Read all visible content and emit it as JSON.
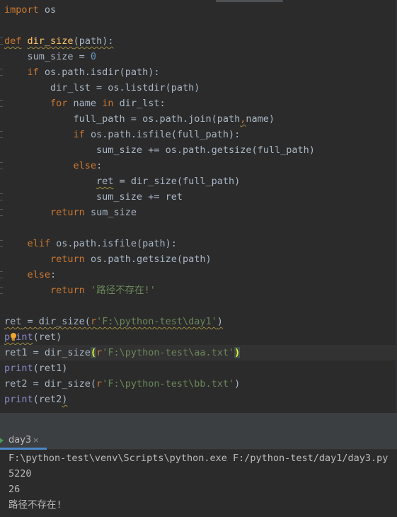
{
  "editor": {
    "lines": [
      {
        "segments": [
          {
            "t": "import",
            "c": "kw"
          },
          {
            "t": " os",
            "c": "pl"
          }
        ]
      },
      {
        "segments": []
      },
      {
        "segments": [
          {
            "t": "def",
            "c": "kw sq"
          },
          {
            "t": " ",
            "c": "pl"
          },
          {
            "t": "dir_size",
            "c": "fn sq"
          },
          {
            "t": "(path):",
            "c": "pl sq"
          }
        ],
        "fold": true
      },
      {
        "segments": [
          {
            "t": "    sum_size = ",
            "c": "pl"
          },
          {
            "t": "0",
            "c": "num"
          }
        ]
      },
      {
        "segments": [
          {
            "t": "    ",
            "c": "pl"
          },
          {
            "t": "if",
            "c": "kw"
          },
          {
            "t": " os.path.isdir(path):",
            "c": "pl"
          }
        ],
        "fold": true
      },
      {
        "segments": [
          {
            "t": "        dir_lst = os.listdir(path)",
            "c": "pl"
          }
        ]
      },
      {
        "segments": [
          {
            "t": "        ",
            "c": "pl"
          },
          {
            "t": "for",
            "c": "kw"
          },
          {
            "t": " name ",
            "c": "pl"
          },
          {
            "t": "in",
            "c": "kw"
          },
          {
            "t": " dir_lst:",
            "c": "pl"
          }
        ],
        "fold": true
      },
      {
        "segments": [
          {
            "t": "            full_path = os.path.join(path",
            "c": "pl"
          },
          {
            "t": ",",
            "c": "kw sq"
          },
          {
            "t": "name)",
            "c": "pl"
          }
        ]
      },
      {
        "segments": [
          {
            "t": "            ",
            "c": "pl"
          },
          {
            "t": "if",
            "c": "kw"
          },
          {
            "t": " os.path.isfile(full_path):",
            "c": "pl"
          }
        ],
        "fold": true
      },
      {
        "segments": [
          {
            "t": "                sum_size += os.path.getsize(full_path)",
            "c": "pl"
          }
        ]
      },
      {
        "segments": [
          {
            "t": "            ",
            "c": "pl"
          },
          {
            "t": "else",
            "c": "kw"
          },
          {
            "t": ":",
            "c": "pl"
          }
        ],
        "fold": true
      },
      {
        "segments": [
          {
            "t": "                ",
            "c": "pl"
          },
          {
            "t": "ret",
            "c": "pl sq"
          },
          {
            "t": " = dir_size(full_path)",
            "c": "pl"
          }
        ]
      },
      {
        "segments": [
          {
            "t": "                sum_size += ret",
            "c": "pl"
          }
        ],
        "fold": true
      },
      {
        "segments": [
          {
            "t": "        ",
            "c": "pl"
          },
          {
            "t": "return",
            "c": "kw"
          },
          {
            "t": " sum_size",
            "c": "pl"
          }
        ],
        "fold": true
      },
      {
        "segments": []
      },
      {
        "segments": [
          {
            "t": "    ",
            "c": "pl"
          },
          {
            "t": "elif",
            "c": "kw"
          },
          {
            "t": " os.path.isfile(path):",
            "c": "pl"
          }
        ],
        "fold": true
      },
      {
        "segments": [
          {
            "t": "        ",
            "c": "pl"
          },
          {
            "t": "return",
            "c": "kw"
          },
          {
            "t": " os.path.getsize(path)",
            "c": "pl"
          }
        ]
      },
      {
        "segments": [
          {
            "t": "    ",
            "c": "pl"
          },
          {
            "t": "else",
            "c": "kw"
          },
          {
            "t": ":",
            "c": "pl"
          }
        ],
        "fold": true
      },
      {
        "segments": [
          {
            "t": "        ",
            "c": "pl"
          },
          {
            "t": "return",
            "c": "kw"
          },
          {
            "t": " ",
            "c": "pl"
          },
          {
            "t": "'路径不存在!'",
            "c": "str"
          }
        ],
        "fold": true
      },
      {
        "segments": []
      },
      {
        "segments": [
          {
            "t": "ret",
            "c": "pl sq"
          },
          {
            "t": " = dir_size(",
            "c": "pl sq"
          },
          {
            "t": "r",
            "c": "pfx sq"
          },
          {
            "t": "'F:\\python-test\\day1'",
            "c": "str sq"
          },
          {
            "t": ")",
            "c": "pl sq"
          }
        ]
      },
      {
        "segments": [
          {
            "t": "print",
            "c": "builtin sq"
          },
          {
            "t": "(ret)",
            "c": "pl"
          }
        ],
        "bulb": true
      },
      {
        "segments": [
          {
            "t": "ret1 = dir_size",
            "c": "pl"
          },
          {
            "t": "(",
            "c": "bh"
          },
          {
            "t": "r",
            "c": "pfx"
          },
          {
            "t": "'F:\\python-test\\aa.txt'",
            "c": "str"
          },
          {
            "t": ")",
            "c": "bh"
          }
        ],
        "current": true
      },
      {
        "segments": [
          {
            "t": "print",
            "c": "builtin"
          },
          {
            "t": "(ret1)",
            "c": "pl"
          }
        ]
      },
      {
        "segments": [
          {
            "t": "ret2 = dir_size(",
            "c": "pl"
          },
          {
            "t": "r",
            "c": "pfx"
          },
          {
            "t": "'F:\\python-test\\bb.txt'",
            "c": "str"
          },
          {
            "t": ")",
            "c": "pl"
          }
        ]
      },
      {
        "segments": [
          {
            "t": "print",
            "c": "builtin"
          },
          {
            "t": "(ret2",
            "c": "pl"
          },
          {
            "t": ")",
            "c": "pl sq"
          }
        ]
      }
    ]
  },
  "run_panel": {
    "tab_label": "day3",
    "close_glyph": "×",
    "output": [
      "F:\\python-test\\venv\\Scripts\\python.exe F:/python-test/day1/day3.py",
      "5220",
      "26",
      "路径不存在!"
    ]
  }
}
